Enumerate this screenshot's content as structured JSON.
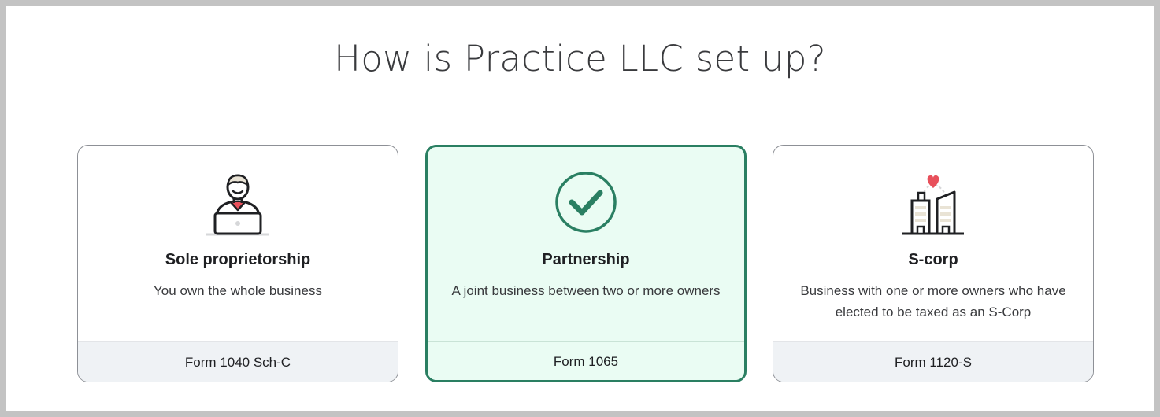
{
  "page": {
    "title": "How is Practice LLC set up?"
  },
  "options": [
    {
      "id": "sole",
      "title": "Sole proprietorship",
      "description": "You own the whole business",
      "form": "Form 1040 Sch-C",
      "icon": "person-laptop-icon",
      "selected": false
    },
    {
      "id": "partnership",
      "title": "Partnership",
      "description": "A joint business between two or more owners",
      "form": "Form 1065",
      "icon": "checkmark-circle-icon",
      "selected": true
    },
    {
      "id": "scorp",
      "title": "S-corp",
      "description": "Business with one or more owners who have elected to be taxed as an S-Corp",
      "form": "Form 1120-S",
      "icon": "buildings-heart-icon",
      "selected": false
    }
  ],
  "colors": {
    "selected_border": "#2a7f62",
    "selected_background": "#eafcf3",
    "check": "#2a7f62",
    "heart": "#e8505b",
    "collar": "#e8505b",
    "text_dark": "#393a3d",
    "card_border": "#8d9096",
    "footer_background": "#eff2f5"
  }
}
